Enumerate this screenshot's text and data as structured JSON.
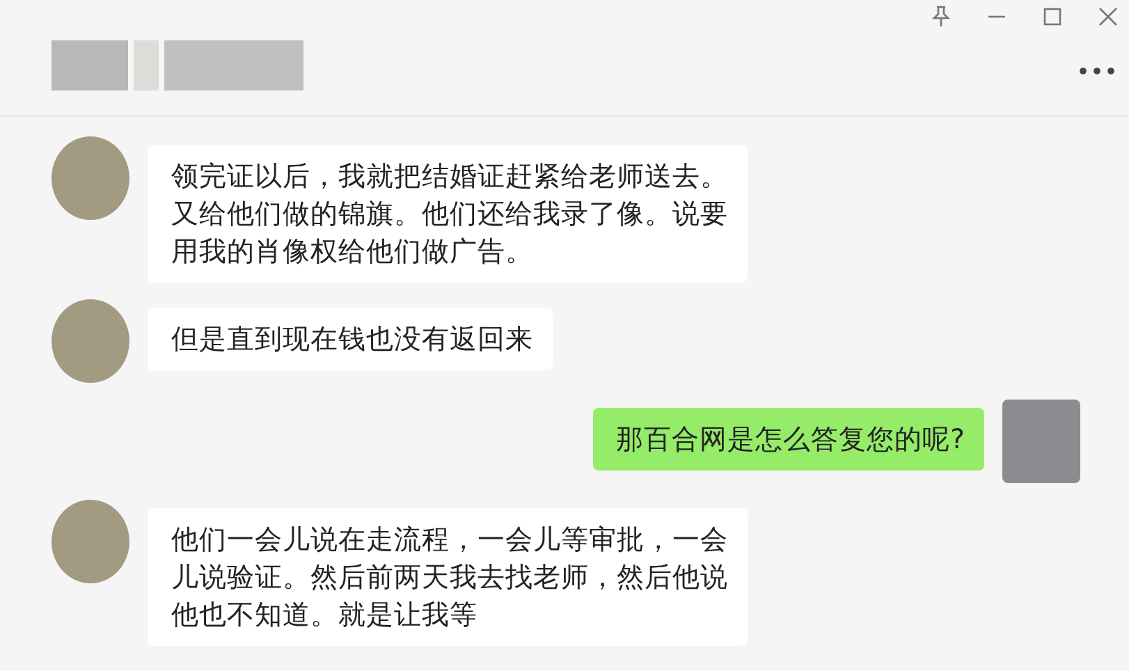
{
  "messages": [
    {
      "kind": "left",
      "text": "领完证以后，我就把结婚证赶紧给老师送去。又给他们做的锦旗。他们还给我录了像。说要用我的肖像权给他们做广告。"
    },
    {
      "kind": "left",
      "text": "但是直到现在钱也没有返回来"
    },
    {
      "kind": "right",
      "text": "那百合网是怎么答复您的呢?"
    },
    {
      "kind": "left",
      "text": "他们一会儿说在走流程，一会儿等审批，一会儿说验证。然后前两天我去找老师，然后他说他也不知道。就是让我等"
    }
  ]
}
